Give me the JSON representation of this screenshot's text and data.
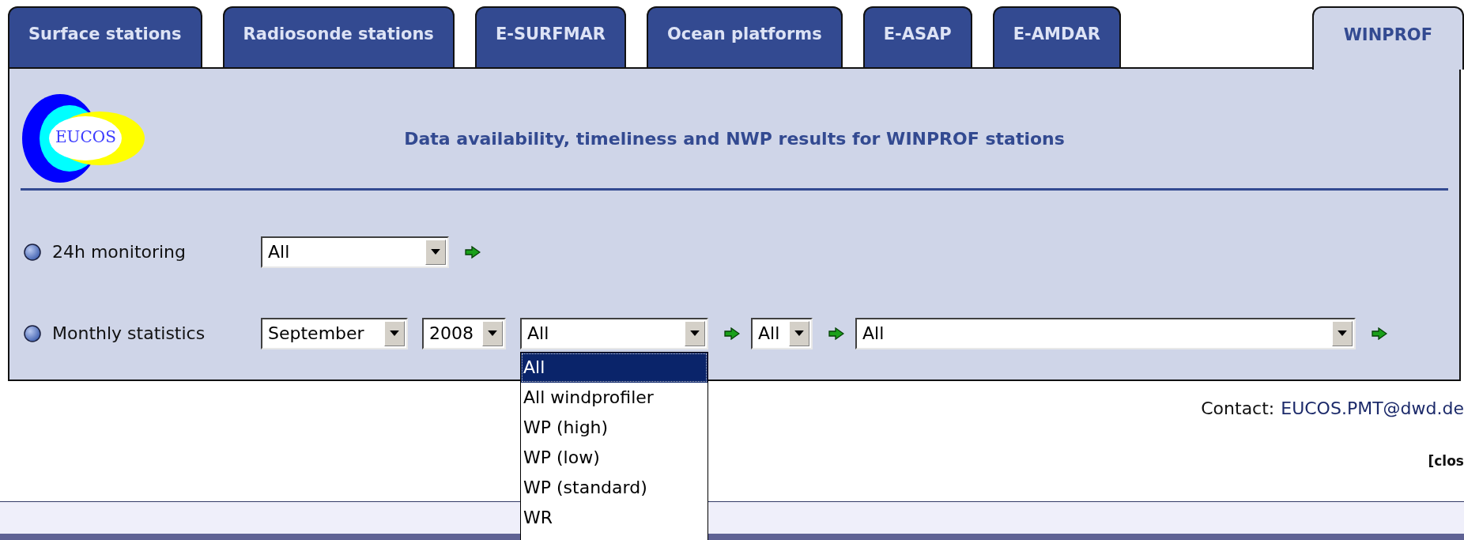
{
  "tabs": [
    {
      "label": "Surface stations",
      "selected": false
    },
    {
      "label": "Radiosonde stations",
      "selected": false
    },
    {
      "label": "E-SURFMAR",
      "selected": false
    },
    {
      "label": "Ocean platforms",
      "selected": false
    },
    {
      "label": "E-ASAP",
      "selected": false
    },
    {
      "label": "E-AMDAR",
      "selected": false
    },
    {
      "label": "WINPROF",
      "selected": true
    }
  ],
  "logo": {
    "text": "EUCOS"
  },
  "title": "Data availability, timeliness and NWP results for WINPROF stations",
  "rows": [
    {
      "label": "24h monitoring",
      "controls": [
        {
          "kind": "select",
          "value": "All"
        },
        {
          "kind": "go"
        }
      ]
    },
    {
      "label": "Monthly statistics",
      "controls": [
        {
          "kind": "select",
          "value": "September"
        },
        {
          "kind": "select",
          "value": "2008"
        },
        {
          "kind": "select",
          "value": "All",
          "expanded": true
        },
        {
          "kind": "go"
        },
        {
          "kind": "select",
          "value": "All"
        },
        {
          "kind": "go"
        },
        {
          "kind": "select",
          "value": "All"
        },
        {
          "kind": "go"
        }
      ]
    }
  ],
  "dropdown_options": [
    {
      "label": "All",
      "selected": true
    },
    {
      "label": "All windprofiler",
      "selected": false
    },
    {
      "label": "WP (high)",
      "selected": false
    },
    {
      "label": "WP (low)",
      "selected": false
    },
    {
      "label": "WP (standard)",
      "selected": false
    },
    {
      "label": "WR",
      "selected": false
    }
  ],
  "contact": {
    "label": "Contact:",
    "link": "EUCOS.PMT@dwd.de"
  },
  "close_link": "[clos"
}
